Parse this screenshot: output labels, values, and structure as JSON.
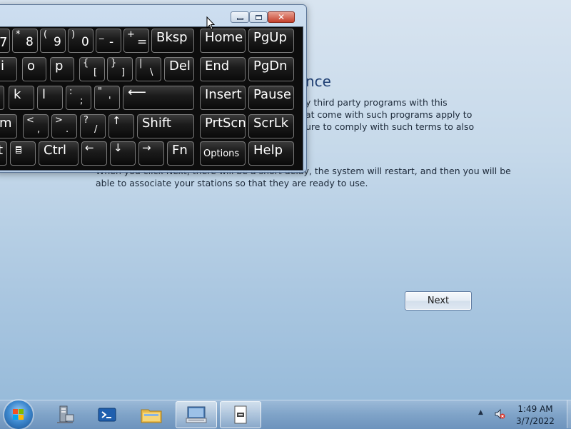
{
  "wizard": {
    "heading_partial": "nce",
    "paragraph1_lines": [
      "y third party programs with this",
      "at come with such programs apply to",
      "ure to comply with such terms to also"
    ],
    "paragraph2_lines": [
      "When you click Next, there will be a short delay, the system will restart, and then you will be",
      "able to associate your stations so that they are ready to use."
    ],
    "next_label": "Next"
  },
  "osk": {
    "row1": [
      {
        "shift": "*",
        "base": "8"
      },
      {
        "shift": "(",
        "base": "9"
      },
      {
        "shift": ")",
        "base": "0"
      },
      {
        "shift": "_",
        "base": "-"
      },
      {
        "shift": "+",
        "base": "="
      }
    ],
    "row1_partial": "7",
    "row2_letters": [
      "i",
      "o",
      "p"
    ],
    "row2_sym": [
      {
        "shift": "{",
        "base": "["
      },
      {
        "shift": "}",
        "base": "]"
      },
      {
        "shift": "|",
        "base": "\\"
      }
    ],
    "row3_letters": [
      "k",
      "l"
    ],
    "row3_sym": [
      {
        "shift": ":",
        "base": ";"
      },
      {
        "shift": "\"",
        "base": "'"
      }
    ],
    "row4_letter": "m",
    "row4_sym": [
      {
        "shift": "<",
        "base": ","
      },
      {
        "shift": ">",
        "base": "."
      },
      {
        "shift": "?",
        "base": "/"
      }
    ],
    "row5_partial": "t",
    "keys": {
      "bksp": "Bksp",
      "home": "Home",
      "pgup": "PgUp",
      "del": "Del",
      "end": "End",
      "pgdn": "PgDn",
      "insert": "Insert",
      "pause": "Pause",
      "shift": "Shift",
      "prtscn": "PrtScn",
      "scrlk": "ScrLk",
      "ctrl": "Ctrl",
      "fn": "Fn",
      "options": "Options",
      "help": "Help",
      "arrow_up": "↑",
      "arrow_left": "←",
      "arrow_down": "↓",
      "arrow_right": "→",
      "enter_glyph": "⟵"
    }
  },
  "taskbar": {
    "time": "1:49 AM",
    "date": "3/7/2022"
  },
  "colors": {
    "accent": "#1f3f73",
    "close_red": "#c5412c",
    "key_bg": "#1c1c1c"
  }
}
